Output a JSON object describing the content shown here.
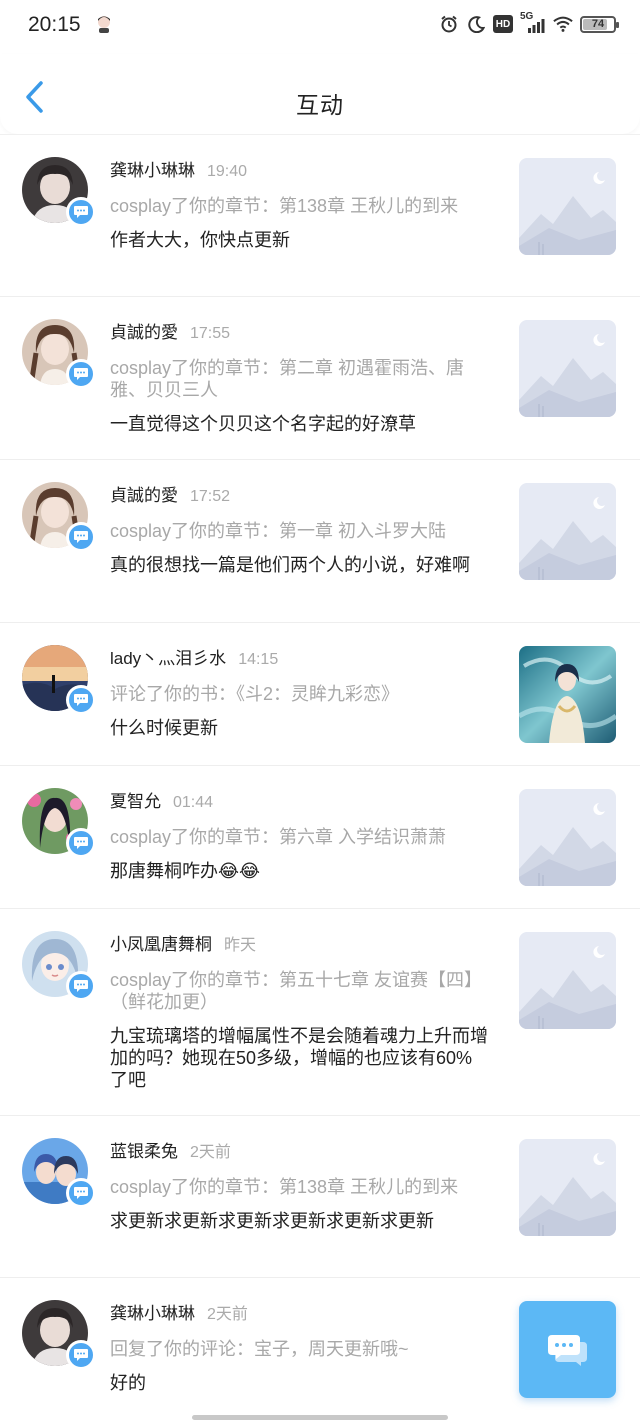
{
  "status_bar": {
    "time": "20:15",
    "battery": "74",
    "network": "5G",
    "icons": [
      "alarm-icon",
      "moon-icon",
      "hd-icon",
      "signal-icon",
      "wifi-icon",
      "battery-icon"
    ]
  },
  "header": {
    "title": "互动",
    "back_icon": "chevron-left-icon"
  },
  "colors": {
    "accent": "#4ea7f2",
    "fab": "#5cb8f5",
    "muted_text": "#a8a8a8",
    "placeholder_bg": "#e6eaf4"
  },
  "items": [
    {
      "name": "龚琳小琳琳",
      "time": "19:40",
      "action": "cosplay了你的章节：第138章 王秋儿的到来",
      "comment": "作者大大，你快点更新",
      "thumb": "placeholder"
    },
    {
      "name": "貞誠的愛",
      "time": "17:55",
      "action": "cosplay了你的章节：第二章 初遇霍雨浩、唐雅、贝贝三人",
      "comment": "一直觉得这个贝贝这个名字起的好潦草",
      "thumb": "placeholder"
    },
    {
      "name": "貞誠的愛",
      "time": "17:52",
      "action": "cosplay了你的章节：第一章 初入斗罗大陆",
      "comment": "真的很想找一篇是他们两个人的小说，好难啊",
      "thumb": "placeholder"
    },
    {
      "name": "lady丶灬泪彡水",
      "time": "14:15",
      "action": "评论了你的书：《斗2：灵眸九彩恋》",
      "comment": "什么时候更新",
      "thumb": "cover"
    },
    {
      "name": "夏智允",
      "time": "01:44",
      "action": "cosplay了你的章节：第六章 入学结识萧萧",
      "comment": "那唐舞桐咋办😂😂",
      "thumb": "placeholder"
    },
    {
      "name": "小凤凰唐舞桐",
      "time": "昨天",
      "action": "cosplay了你的章节：第五十七章 友谊赛【四】（鲜花加更）",
      "comment": "九宝琉璃塔的增幅属性不是会随着魂力上升而增加的吗？她现在50多级，增幅的也应该有60%了吧",
      "thumb": "placeholder"
    },
    {
      "name": "蓝银柔兔",
      "time": "2天前",
      "action": "cosplay了你的章节：第138章 王秋儿的到来",
      "comment": "求更新求更新求更新求更新求更新求更新",
      "thumb": "placeholder"
    },
    {
      "name": "龚琳小琳琳",
      "time": "2天前",
      "action": "回复了你的评论：宝子，周天更新哦~",
      "comment": "好的",
      "thumb": "none"
    }
  ],
  "fab": {
    "icon": "chat-bubble-icon"
  }
}
